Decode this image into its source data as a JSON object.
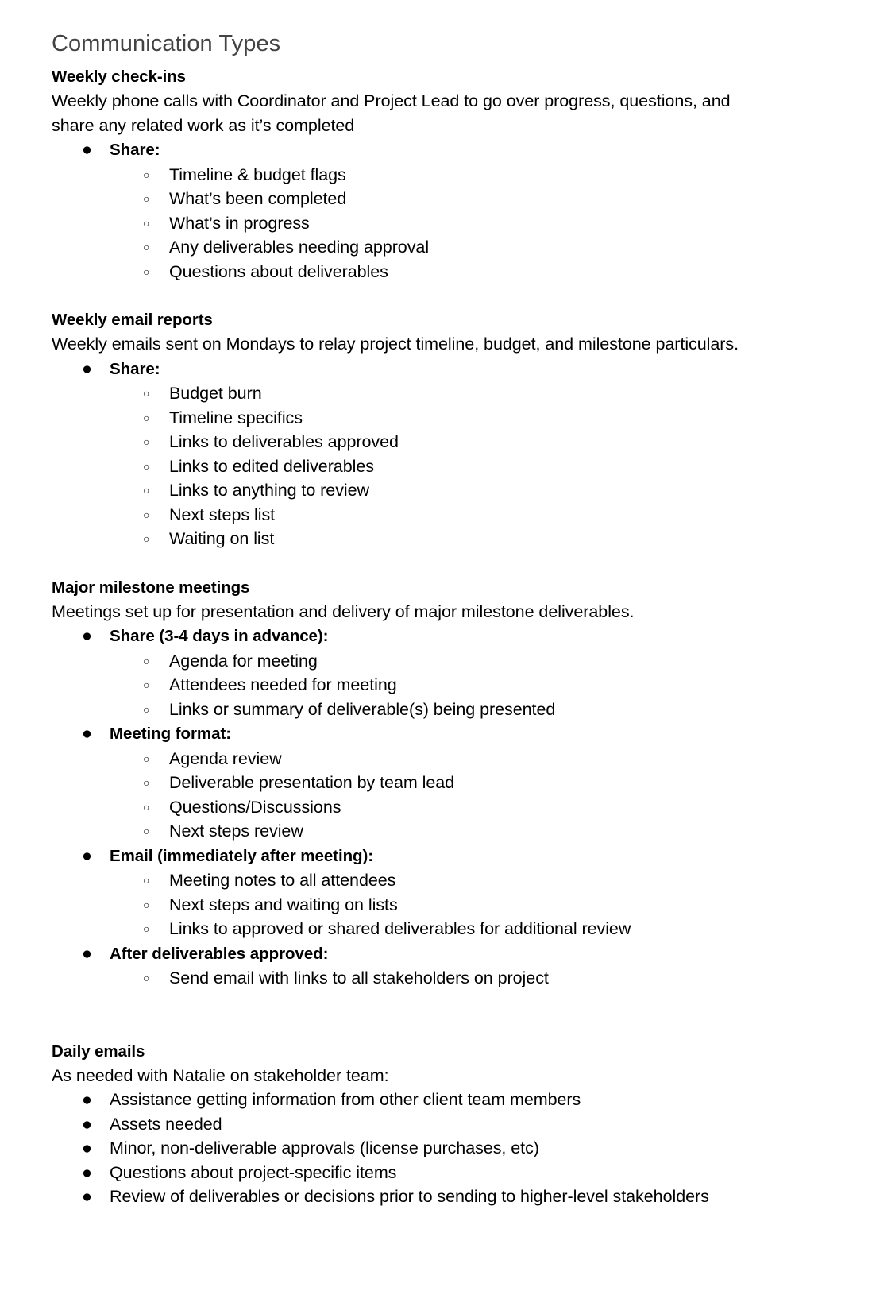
{
  "document": {
    "title": "Communication Types",
    "title_color": "#434343",
    "bullet_level1_glyph": "●",
    "bullet_level2_glyph": "○"
  },
  "sections": [
    {
      "heading": "Weekly check-ins",
      "intro": "Weekly phone calls with Coordinator and Project Lead to go over progress, questions, and share any related work as it’s completed",
      "groups": [
        {
          "label": "Share:",
          "bold": true,
          "items": [
            "Timeline & budget flags",
            "What’s been completed",
            "What’s in progress",
            "Any deliverables needing approval",
            "Questions about deliverables"
          ]
        }
      ]
    },
    {
      "heading": "Weekly email reports",
      "intro": "Weekly emails sent on Mondays to relay project timeline, budget, and milestone particulars.",
      "groups": [
        {
          "label": "Share:",
          "bold": true,
          "items": [
            "Budget burn",
            "Timeline specifics",
            "Links to deliverables approved",
            "Links to edited deliverables",
            "Links to anything to review",
            "Next steps list",
            "Waiting on list"
          ]
        }
      ]
    },
    {
      "heading": "Major milestone meetings",
      "intro": "Meetings set up for presentation and delivery of major milestone deliverables.",
      "groups": [
        {
          "label": "Share (3-4 days in advance):",
          "bold": true,
          "items": [
            "Agenda for meeting",
            "Attendees needed for meeting",
            "Links or summary of deliverable(s) being presented"
          ]
        },
        {
          "label": "Meeting format:",
          "bold": true,
          "items": [
            "Agenda review",
            "Deliverable presentation by team lead",
            "Questions/Discussions",
            "Next steps review"
          ]
        },
        {
          "label": "Email (immediately after meeting):",
          "bold": true,
          "items": [
            "Meeting notes to all attendees",
            "Next steps and waiting on lists",
            "Links to approved or shared deliverables for additional review"
          ]
        },
        {
          "label": "After deliverables approved:",
          "bold": true,
          "items": [
            "Send email with links to all stakeholders on project"
          ]
        }
      ]
    },
    {
      "heading": "Daily emails",
      "intro": "As needed with Natalie on stakeholder team:",
      "extra_gap": true,
      "flat_items": [
        "Assistance getting information from other client team members",
        "Assets needed",
        "Minor, non-deliverable approvals (license purchases, etc)",
        "Questions about project-specific items",
        "Review of deliverables or decisions prior to sending to higher-level stakeholders"
      ]
    }
  ]
}
